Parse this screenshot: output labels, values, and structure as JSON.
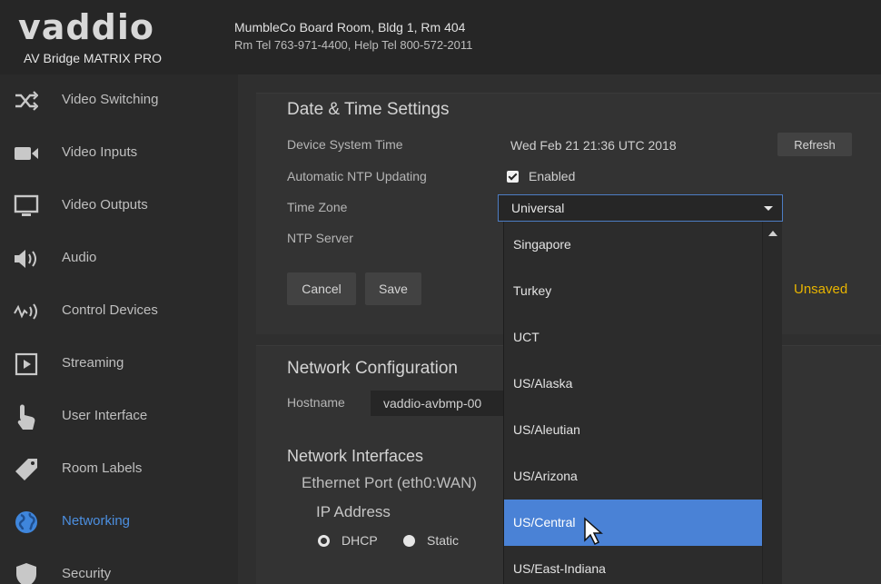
{
  "header": {
    "logo_text": "vaddio",
    "product": "AV Bridge MATRIX PRO",
    "room_name": "MumbleCo Board Room, Bldg 1, Rm 404",
    "room_phones": "Rm Tel 763-971-4400, Help Tel 800-572-2011"
  },
  "sidebar": {
    "items": [
      {
        "label": "Video Switching",
        "icon": "shuffle-icon"
      },
      {
        "label": "Video Inputs",
        "icon": "video-camera-icon"
      },
      {
        "label": "Video Outputs",
        "icon": "monitor-icon"
      },
      {
        "label": "Audio",
        "icon": "speaker-icon"
      },
      {
        "label": "Control Devices",
        "icon": "signal-icon"
      },
      {
        "label": "Streaming",
        "icon": "play-icon"
      },
      {
        "label": "User Interface",
        "icon": "touch-hand-icon"
      },
      {
        "label": "Room Labels",
        "icon": "tag-icon"
      },
      {
        "label": "Networking",
        "icon": "globe-icon"
      },
      {
        "label": "Security",
        "icon": "shield-icon"
      }
    ],
    "active_index": 8,
    "active_color": "#4c8fe0"
  },
  "datetime": {
    "title": "Date & Time Settings",
    "system_time_label": "Device System Time",
    "system_time_value": "Wed Feb 21 21:36 UTC 2018",
    "refresh_label": "Refresh",
    "ntp_label": "Automatic NTP Updating",
    "ntp_enabled_label": "Enabled",
    "ntp_enabled": true,
    "timezone_label": "Time Zone",
    "timezone_value": "Universal",
    "ntp_server_label": "NTP Server",
    "cancel_label": "Cancel",
    "save_label": "Save",
    "unsaved_label": "Unsaved",
    "unsaved_color": "#e8b400"
  },
  "timezone_dropdown": {
    "options": [
      "Singapore",
      "Turkey",
      "UCT",
      "US/Alaska",
      "US/Aleutian",
      "US/Arizona",
      "US/Central",
      "US/East-Indiana"
    ],
    "highlighted": "US/Central",
    "highlight_color": "#4a82d6"
  },
  "network": {
    "title": "Network Configuration",
    "hostname_label": "Hostname",
    "hostname_value": "vaddio-avbmp-00",
    "interfaces_title": "Network Interfaces",
    "port_label": "Ethernet Port (eth0:WAN)",
    "ip_title": "IP Address",
    "dhcp_label": "DHCP",
    "static_label": "Static",
    "mode": "DHCP"
  }
}
